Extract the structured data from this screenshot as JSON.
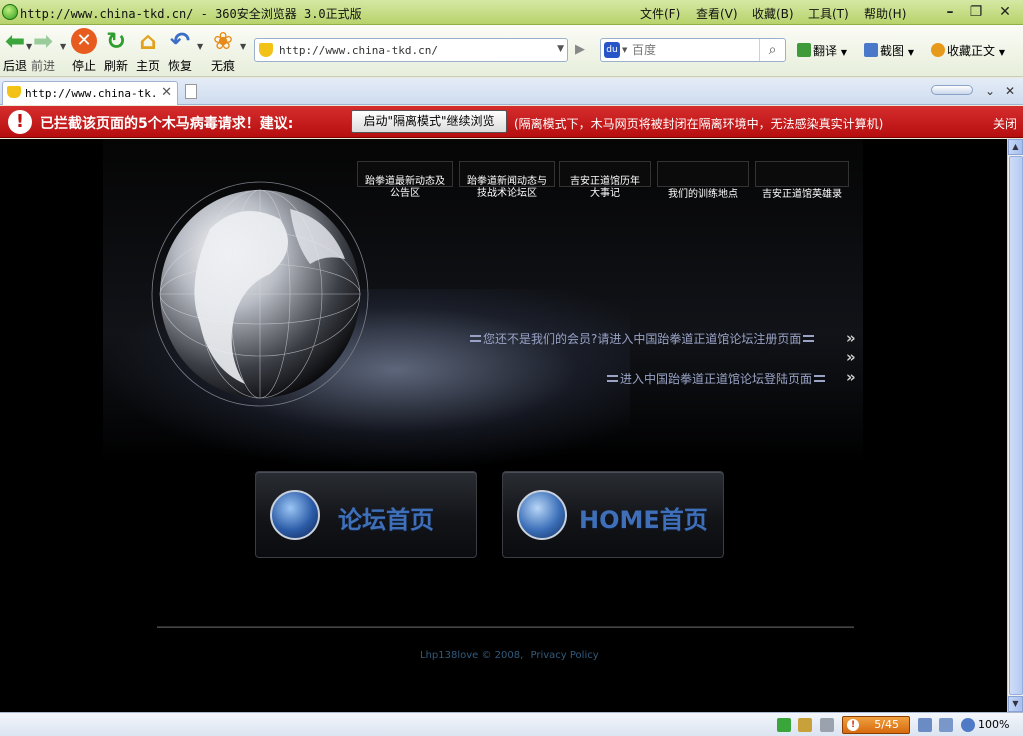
{
  "window": {
    "title": "http://www.china-tkd.cn/ - 360安全浏览器 3.0正式版",
    "menu": [
      "文件(F)",
      "查看(V)",
      "收藏(B)",
      "工具(T)",
      "帮助(H)"
    ],
    "controls": {
      "minimize": "–",
      "restore": "❐",
      "close": "✕"
    }
  },
  "toolbar": {
    "back": "后退",
    "forward": "前进",
    "stop": "停止",
    "refresh": "刷新",
    "home": "主页",
    "restore": "恢复",
    "incognito": "无痕",
    "address_value": "http://www.china-tkd.cn/",
    "search_placeholder": "百度",
    "translate": "翻译",
    "screenshot": "截图",
    "favorites_text": "收藏正文"
  },
  "tabs": {
    "active_title": "http://www.china-tk...",
    "close": "✕"
  },
  "warning": {
    "message": "已拦截该页面的5个木马病毒请求！建议:",
    "button": "启动\"隔离模式\"继续浏览",
    "description": "(隔离模式下，木马网页将被封闭在隔离环境中，无法感染真实计算机)",
    "close": "关闭"
  },
  "page": {
    "nav": [
      {
        "line1": "跆拳道最新动态及",
        "line2": "公告区"
      },
      {
        "line1": "跆拳道新闻动态与",
        "line2": "技战术论坛区"
      },
      {
        "line1": "吉安正道馆历年",
        "line2": "大事记"
      },
      {
        "line1": "我们的训练地点",
        "line2": ""
      },
      {
        "line1": "吉安正道馆英雄录",
        "line2": ""
      }
    ],
    "register_text": "您还不是我们的会员?请进入中国跆拳道正道馆论坛注册页面",
    "login_text": "进入中国跆拳道正道馆论坛登陆页面",
    "forum_button": "论坛首页",
    "home_button": "HOME首页",
    "copyright": "Lhp138love © 2008,",
    "privacy": "Privacy Policy"
  },
  "status": {
    "warnings": "5/45",
    "zoom": "100%"
  },
  "colors": {
    "accent_green": "#2d9a1e",
    "warning_red": "#c01010",
    "button_text_blue": "#3e6fb8",
    "link_grey_blue": "#9aa3c6"
  }
}
